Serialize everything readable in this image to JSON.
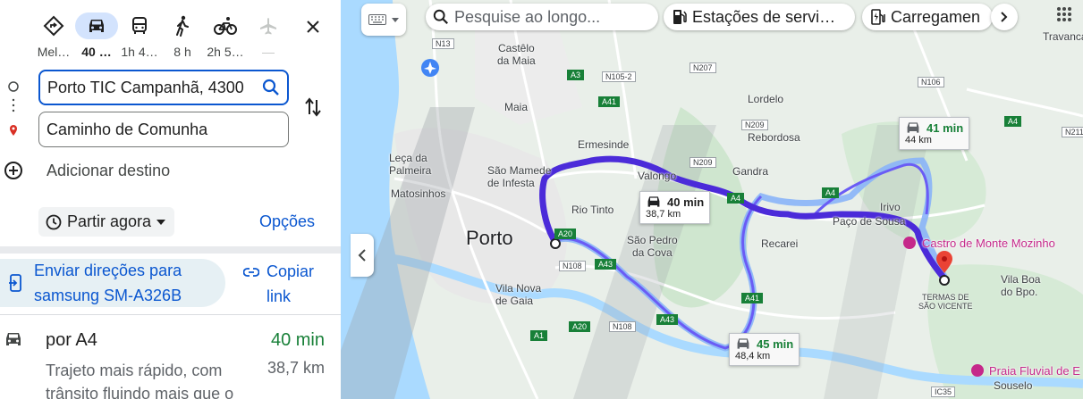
{
  "modes": [
    {
      "name": "mode-best",
      "label": "Mel…",
      "active": false
    },
    {
      "name": "mode-car",
      "label": "40 …",
      "active": true
    },
    {
      "name": "mode-transit",
      "label": "1h 4…",
      "active": false
    },
    {
      "name": "mode-walk",
      "label": "8 h",
      "active": false
    },
    {
      "name": "mode-bike",
      "label": "2h 5…",
      "active": false
    },
    {
      "name": "mode-flight",
      "label": "—",
      "active": false
    }
  ],
  "origin": {
    "value": "Porto TIC Campanhã, 4300"
  },
  "destination": {
    "value": "Caminho de Comunha"
  },
  "add_destination": "Adicionar destino",
  "depart": {
    "label": "Partir agora"
  },
  "options_label": "Opções",
  "send": {
    "line1": "Enviar direções para",
    "line2": "samsung SM-A326B"
  },
  "copy": {
    "line1": "Copiar",
    "line2": "link"
  },
  "route_option": {
    "name": "por A4",
    "time": "40 min",
    "distance": "38,7 km",
    "description": "Trajeto mais rápido, com trânsito fluindo mais que o"
  },
  "search": {
    "placeholder": "Pesquise ao longo..."
  },
  "chips": {
    "fuel": "Estações de servi…",
    "charging": "Carregamen"
  },
  "map": {
    "labels": {
      "castelo": "Castêlo\nda Maia",
      "maia": "Maia",
      "lordelo": "Lordelo",
      "rebordosa": "Rebordosa",
      "lecadapalmeira": "Leça da\nPalmeira",
      "saomamede": "São Mamede\nde Infesta",
      "ermesinde": "Ermesinde",
      "valongo": "Valongo",
      "gandra": "Gandra",
      "matosinhos": "Matosinhos",
      "riotinto": "Rio Tinto",
      "porto": "Porto",
      "saopedro": "São Pedro\nda Cova",
      "recarei": "Recarei",
      "irivo": "Irivo",
      "pacodesousa": "Paço de Sousa",
      "castro": "Castro de Monte Mozinho",
      "vilanova": "Vila Nova\nde Gaia",
      "termas": "TERMAS DE\nSÃO VICENTE",
      "vilaboa": "Vila Boa\ndo Bpo.",
      "praia": "Praia Fluvial de E",
      "souselo": "Souselo",
      "travanca": "Travanca"
    },
    "roads": [
      "N13",
      "A3",
      "N105-2",
      "N207",
      "A41",
      "N209",
      "N106",
      "N209",
      "A4",
      "A4",
      "A20",
      "N108",
      "A43",
      "A41",
      "A43",
      "N108",
      "A1",
      "A20",
      "A4",
      "N211",
      "IC35"
    ],
    "bubbles": {
      "main": {
        "time": "40 min",
        "distance": "38,7 km"
      },
      "alt1": {
        "time": "41 min",
        "distance": "44 km"
      },
      "alt2": {
        "time": "45 min",
        "distance": "48,4 km"
      }
    }
  },
  "colors": {
    "route": "#4b2bd9",
    "route_alt": "#8ab4f8",
    "accent": "#0b57d0",
    "time_green": "#188038"
  }
}
